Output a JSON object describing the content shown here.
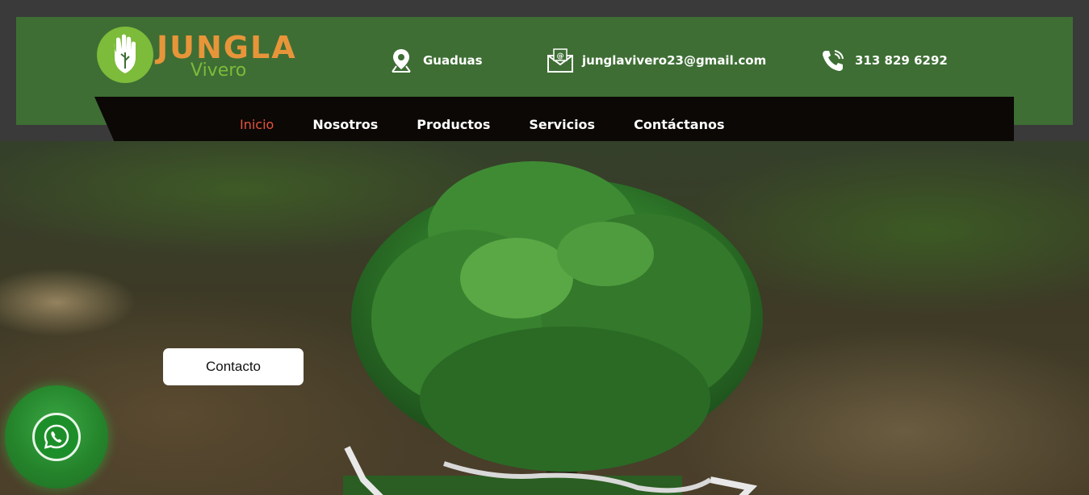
{
  "brand": {
    "name": "JUNGLA",
    "subtitle": "Vivero",
    "primary_color": "#3e6e34",
    "accent_color": "#e8953a",
    "logo_icon": "hand-leaf-icon"
  },
  "header": {
    "location": {
      "icon": "location-pin-icon",
      "text": "Guaduas"
    },
    "email": {
      "icon": "envelope-icon",
      "text": "junglavivero23@gmail.com"
    },
    "phone": {
      "icon": "phone-icon",
      "text": "313 829 6292"
    }
  },
  "nav": {
    "items": [
      {
        "label": "Inicio",
        "active": true
      },
      {
        "label": "Nosotros",
        "active": false
      },
      {
        "label": "Productos",
        "active": false
      },
      {
        "label": "Servicios",
        "active": false
      },
      {
        "label": "Contáctanos",
        "active": false
      }
    ],
    "active_color": "#e8533a"
  },
  "hero": {
    "button_label": "Contacto",
    "image": "tree-image"
  },
  "floating": {
    "whatsapp_icon": "whatsapp-icon"
  }
}
